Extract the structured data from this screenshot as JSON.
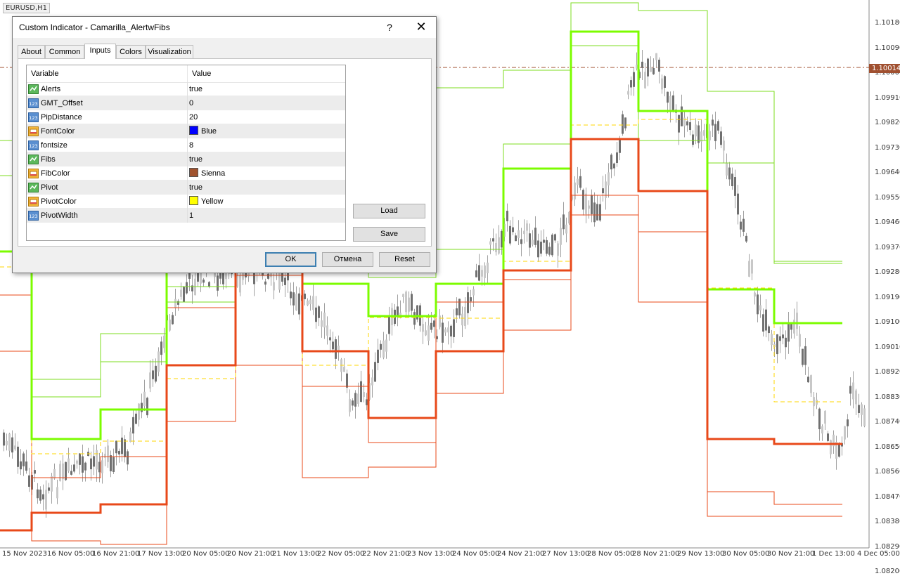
{
  "chart": {
    "symbol_label": "EURUSD,H1",
    "price_labels": [
      "1.10180",
      "1.10090",
      "1.10000",
      "1.09910",
      "1.09820",
      "1.09730",
      "1.09640",
      "1.09550",
      "1.09460",
      "1.09370",
      "1.09280",
      "1.09190",
      "1.09100",
      "1.09010",
      "1.08920",
      "1.08830",
      "1.08740",
      "1.08650",
      "1.08560",
      "1.08470",
      "1.08380",
      "1.08290",
      "1.08200"
    ],
    "current_price": "1.10014",
    "time_labels": [
      "15 Nov 2023",
      "16 Nov 05:00",
      "16 Nov 21:00",
      "17 Nov 13:00",
      "20 Nov 05:00",
      "20 Nov 21:00",
      "21 Nov 13:00",
      "22 Nov 05:00",
      "22 Nov 21:00",
      "23 Nov 13:00",
      "24 Nov 05:00",
      "24 Nov 21:00",
      "27 Nov 13:00",
      "28 Nov 05:00",
      "28 Nov 21:00",
      "29 Nov 13:00",
      "30 Nov 05:00",
      "30 Nov 21:00",
      "1 Dec 13:00",
      "4 Dec 05:00"
    ],
    "colors": {
      "fib_levels": "#7cdc1f",
      "pivot_thick_green": "#7cfc00",
      "pivot_lines": "#e8491a",
      "pivot_center": "#ffd700",
      "candles": "#808080",
      "current_price_line": "#a05030"
    }
  },
  "dialog": {
    "title": "Custom Indicator - Camarilla_AlertwFibs",
    "help_label": "?",
    "close_label": "✕",
    "tabs": [
      {
        "label": "About",
        "active": false
      },
      {
        "label": "Common",
        "active": false
      },
      {
        "label": "Inputs",
        "active": true
      },
      {
        "label": "Colors",
        "active": false
      },
      {
        "label": "Visualization",
        "active": false
      }
    ],
    "grid": {
      "col_variable": "Variable",
      "col_value": "Value",
      "rows": [
        {
          "name": "Alerts",
          "value": "true",
          "icon": "bool-icon"
        },
        {
          "name": "GMT_Offset",
          "value": "0",
          "icon": "number-icon"
        },
        {
          "name": "PipDistance",
          "value": "20",
          "icon": "number-icon"
        },
        {
          "name": "FontColor",
          "value": "Blue",
          "icon": "color-icon",
          "swatch": "#0000ff"
        },
        {
          "name": "fontsize",
          "value": "8",
          "icon": "number-icon"
        },
        {
          "name": "Fibs",
          "value": "true",
          "icon": "bool-icon"
        },
        {
          "name": "FibColor",
          "value": "Sienna",
          "icon": "color-icon",
          "swatch": "#a0522d"
        },
        {
          "name": "Pivot",
          "value": "true",
          "icon": "bool-icon"
        },
        {
          "name": "PivotColor",
          "value": "Yellow",
          "icon": "color-icon",
          "swatch": "#ffff00"
        },
        {
          "name": "PivotWidth",
          "value": "1",
          "icon": "number-icon"
        }
      ]
    },
    "load_label": "Load",
    "save_label": "Save",
    "ok_label": "OK",
    "cancel_label": "Отмена",
    "reset_label": "Reset"
  }
}
